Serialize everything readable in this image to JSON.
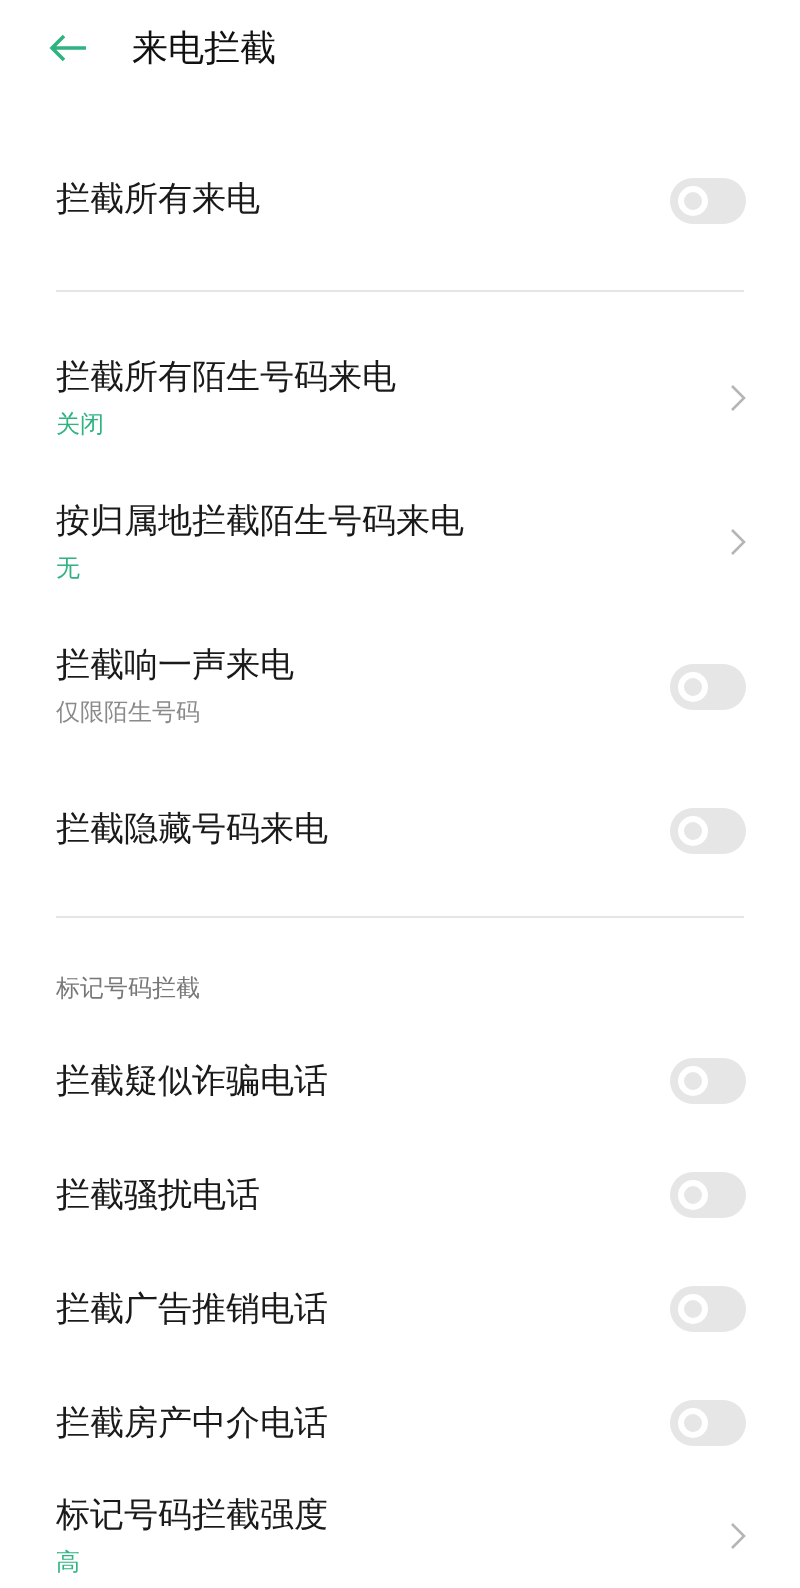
{
  "header": {
    "title": "来电拦截"
  },
  "sections": [
    {
      "items": [
        {
          "kind": "toggle",
          "title": "拦截所有来电",
          "on": false
        }
      ]
    },
    {
      "items": [
        {
          "kind": "link",
          "title": "拦截所有陌生号码来电",
          "subtitle": "关闭"
        },
        {
          "kind": "link",
          "title": "按归属地拦截陌生号码来电",
          "subtitle": "无"
        },
        {
          "kind": "toggle",
          "title": "拦截响一声来电",
          "subtitle": "仅限陌生号码",
          "on": false
        },
        {
          "kind": "toggle",
          "title": "拦截隐藏号码来电",
          "on": false
        }
      ]
    },
    {
      "heading": "标记号码拦截",
      "items": [
        {
          "kind": "toggle",
          "title": "拦截疑似诈骗电话",
          "on": false
        },
        {
          "kind": "toggle",
          "title": "拦截骚扰电话",
          "on": false
        },
        {
          "kind": "toggle",
          "title": "拦截广告推销电话",
          "on": false
        },
        {
          "kind": "toggle",
          "title": "拦截房产中介电话",
          "on": false
        },
        {
          "kind": "link",
          "title": "标记号码拦截强度",
          "subtitle": "高"
        }
      ]
    }
  ]
}
